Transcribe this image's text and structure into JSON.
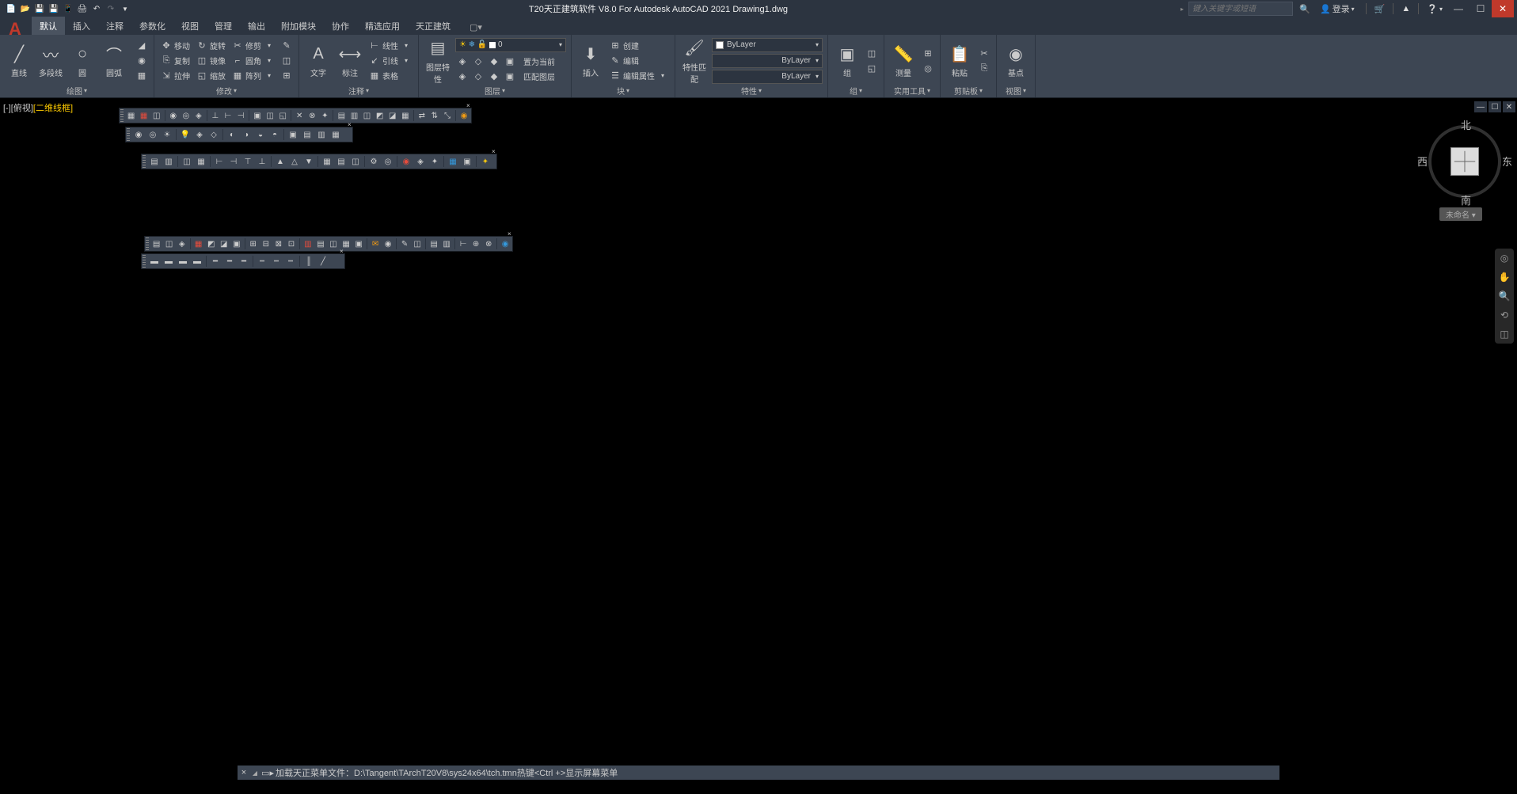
{
  "title_full": "T20天正建筑软件 V8.0 For Autodesk AutoCAD 2021    Drawing1.dwg",
  "search_placeholder": "键入关键字或短语",
  "login_label": "登录",
  "tabs": [
    "默认",
    "插入",
    "注释",
    "参数化",
    "视图",
    "管理",
    "输出",
    "附加模块",
    "协作",
    "精选应用",
    "天正建筑"
  ],
  "ribbon": {
    "draw": {
      "label": "绘图",
      "items": [
        "直线",
        "多段线",
        "圆",
        "圆弧"
      ]
    },
    "modify": {
      "label": "修改",
      "rows": [
        [
          "移动",
          "旋转",
          "修剪"
        ],
        [
          "复制",
          "镜像",
          "圆角"
        ],
        [
          "拉伸",
          "缩放",
          "阵列"
        ]
      ]
    },
    "ann": {
      "label": "注释",
      "big": [
        "文字",
        "标注"
      ],
      "rows": [
        "线性",
        "引线",
        "表格"
      ]
    },
    "layer": {
      "label": "图层",
      "big": "图层特性",
      "cur": "0",
      "rows": [
        "置为当前",
        "匹配图层"
      ]
    },
    "block": {
      "label": "块",
      "big": "插入",
      "rows": [
        "创建",
        "编辑",
        "编辑属性"
      ]
    },
    "props": {
      "label": "特性",
      "big": "特性匹配",
      "layer": "ByLayer",
      "lt": "ByLayer",
      "lw": "ByLayer"
    },
    "group": {
      "label": "组",
      "big": "组"
    },
    "util": {
      "label": "实用工具",
      "big": "测量"
    },
    "clip": {
      "label": "剪贴板",
      "big": "粘贴"
    },
    "view": {
      "label": "视图",
      "big": "基点"
    }
  },
  "viewport_state": {
    "pre": "[-][俯视]",
    "wire": "二维线框"
  },
  "viewcube": {
    "n": "北",
    "s": "南",
    "e": "东",
    "w": "西",
    "wcs": "未命名 ▾"
  },
  "cmdline": {
    "prompt": "▸",
    "text": "加载天正菜单文件：D:\\Tangent\\TArchT20V8\\sys24x64\\tch.tmn热键<Ctrl +>显示屏幕菜单"
  }
}
